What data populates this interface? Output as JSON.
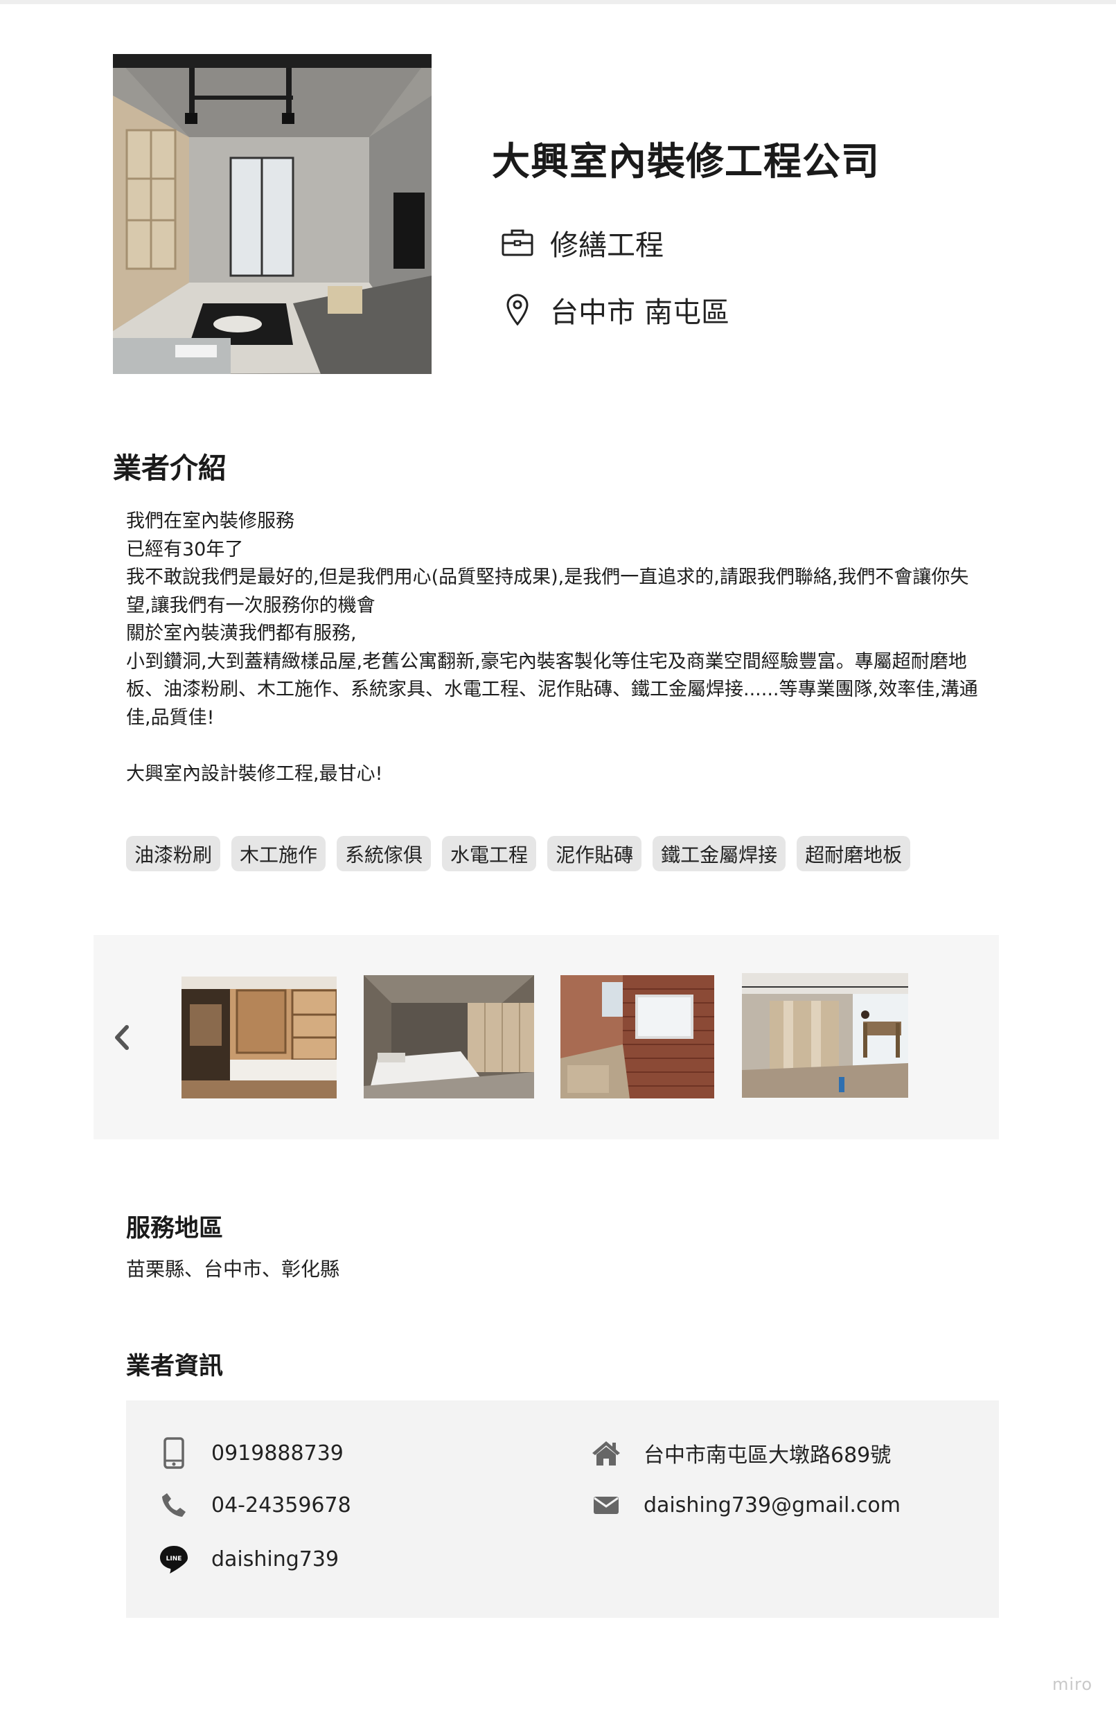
{
  "header": {
    "company_name": "大興室內裝修工程公司",
    "category": "修繕工程",
    "location": "台中市 南屯區",
    "category_icon": "briefcase-icon",
    "location_icon": "map-pin-icon"
  },
  "intro": {
    "title": "業者介紹",
    "paragraphs": [
      "我們在室內裝修服務",
      "已經有30年了",
      "我不敢說我們是最好的,但是我們用心(品質堅持成果),是我們一直追求的,請跟我們聯絡,我們不會讓你失望,讓我們有一次服務你的機會",
      "關於室內裝潢我們都有服務,",
      "小到鑽洞,大到蓋精緻樣品屋,老舊公寓翻新,豪宅內裝客製化等住宅及商業空間經驗豐富。專屬超耐磨地板、油漆粉刷、木工施作、系統家具、水電工程、泥作貼磚、鐵工金屬焊接......等專業團隊,效率佳,溝通佳,品質佳!",
      "",
      "大興室內設計裝修工程,最甘心!"
    ],
    "tags": [
      "油漆粉刷",
      "木工施作",
      "系統傢俱",
      "水電工程",
      "泥作貼磚",
      "鐵工金屬焊接",
      "超耐磨地板"
    ]
  },
  "gallery": {
    "prev_icon": "chevron-left-icon",
    "photos": [
      "kitchen-cabinet-photo",
      "bedroom-photo",
      "brick-wall-photo",
      "renovation-site-photo"
    ]
  },
  "service_area": {
    "title": "服務地區",
    "text": "苗栗縣、台中市、彰化縣"
  },
  "info": {
    "title": "業者資訊",
    "mobile": "0919888739",
    "phone": "04-24359678",
    "line_id": "daishing739",
    "address": "台中市南屯區大墩路689號",
    "email": "daishing739@gmail.com"
  },
  "watermark": "miro",
  "colors": {
    "tag_bg": "#e6e6e6",
    "panel_bg": "#f3f3f3",
    "icon_gray": "#666666",
    "text": "#222222"
  }
}
